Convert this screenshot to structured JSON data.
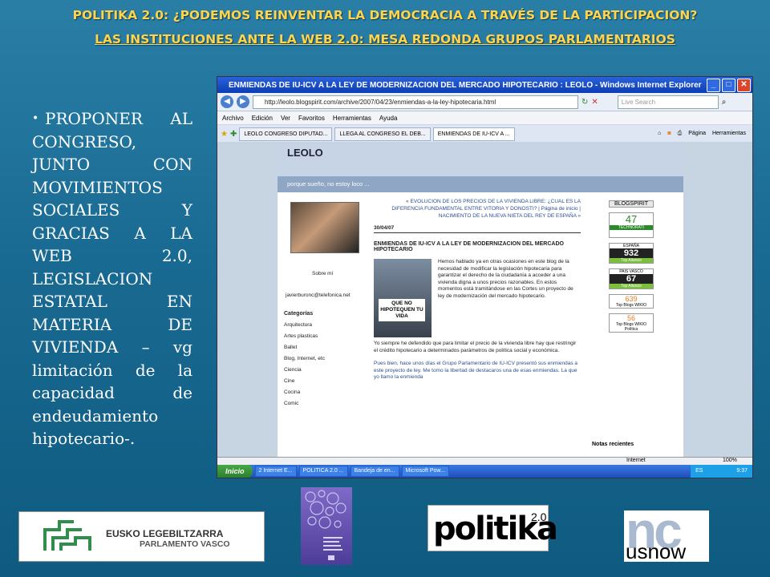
{
  "slide": {
    "title_line1": "POLITIKA 2.0: ¿PODEMOS REINVENTAR LA DEMOCRACIA A TRAVÉS DE LA PARTICIPACION?",
    "title_line2": "LAS INSTITUCIONES ANTE LA WEB 2.0: MESA REDONDA GRUPOS PARLAMENTARIOS",
    "bullet": "PROPONER AL CONGRESO, JUNTO CON MOVIMIENTOS SOCIALES Y GRACIAS A LA WEB 2.0, LEGISLACION ESTATAL EN MATERIA DE VIVIENDA – vg limitación de la capacidad de endeudamiento hipotecario-.",
    "title_color": "#ffd34a"
  },
  "browser": {
    "window_title": "ENMIENDAS DE IU-ICV A LA LEY DE MODERNIZACION DEL MERCADO HIPOTECARIO : LEOLO - Windows Internet Explorer",
    "url": "http://leolo.blogspirit.com/archive/2007/04/23/enmiendas-a-la-ley-hipotecaria.html",
    "search_placeholder": "Live Search",
    "menu": [
      "Archivo",
      "Edición",
      "Ver",
      "Favoritos",
      "Herramientas",
      "Ayuda"
    ],
    "tabs": [
      "LEOLO CONGRESO DIPUTAD...",
      "LLEGA AL CONGRESO EL DEB...",
      "ENMIENDAS DE IU-ICV A ..."
    ],
    "tools": [
      "Página",
      "Herramientas"
    ],
    "status_zone": "Internet",
    "zoom": "100%"
  },
  "blog": {
    "name": "LEOLO",
    "tagline": "porque sueño, no estoy loco ...",
    "about": "Sobre mí",
    "email": "javierburonc@telefonica.net",
    "categories_title": "Categorías",
    "categories": [
      "Arquitectura",
      "Artes plasticas",
      "Ballet",
      "Blog, Internet, etc",
      "Ciencia",
      "Cine",
      "Cocina",
      "Comic"
    ],
    "post_nav": "« EVOLUCION DE LOS PRECIOS DE LA VIVIENDA LIBRE: ¿CUAL ES LA DIFERENCIA FUNDAMENTAL ENTRE VITORIA Y DONOSTI? | Página de inicio | NACIMIENTO DE LA NUEVA NIETA DEL REY DE ESPAÑA »",
    "date": "30/04/07",
    "post_title": "ENMIENDAS DE IU-ICV A LA LEY DE MODERNIZACION DEL MERCADO HIPOTECARIO",
    "image_sign": "QUE NO HIPOTEQUEN TU VIDA",
    "para1": "Hemos hablado ya en otras ocasiones en este blog de la necesidad de modificar la legislación hipotecaria para garantizar el derecho de la ciudadanía a acceder a una vivienda digna a unos precios razonables. En estos momentos está tramitándose en las Cortes un proyecto de ley de modernización del mercado hipotecario.",
    "para2": "Yo siempre he defendido que para limitar el precio de la vivienda libre hay que restringir el crédito hipotecario a determinados parámetros de política social y económica.",
    "para3": "Pues bien, hace unos días el Grupo Parlamentario de IU-ICV presentó sus enmiendas a este proyecto de ley. Me tomo la libertad de destacaros una de esas enmiendas. La que yo llamo la enmienda",
    "notas": "Notas recientes",
    "badges": [
      "BLOGSPIRIT",
      "47",
      "TECHNORATI",
      "ESPAÑA",
      "932",
      "Top Alianzo",
      "PAIS VASCO",
      "67",
      "Top Alianzo",
      "639",
      "Top Blogs WIKIO",
      "56",
      "Top Blogs WIKIO",
      "Política"
    ]
  },
  "taskbar": {
    "start": "Inicio",
    "tasks": [
      "2 Internet E...",
      "POLITICA 2.0 ...",
      "Bandeja de en...",
      "Microsoft Pow..."
    ],
    "lang": "ES",
    "clock": "9:37"
  },
  "logos": {
    "eusko_line1": "EUSKO LEGEBILTZARRA",
    "eusko_line2": "PARLAMENTO VASCO",
    "politika": "politika",
    "politika_sup": "2.0",
    "ncusnow_big": "nc",
    "ncusnow_small": "usnow"
  }
}
